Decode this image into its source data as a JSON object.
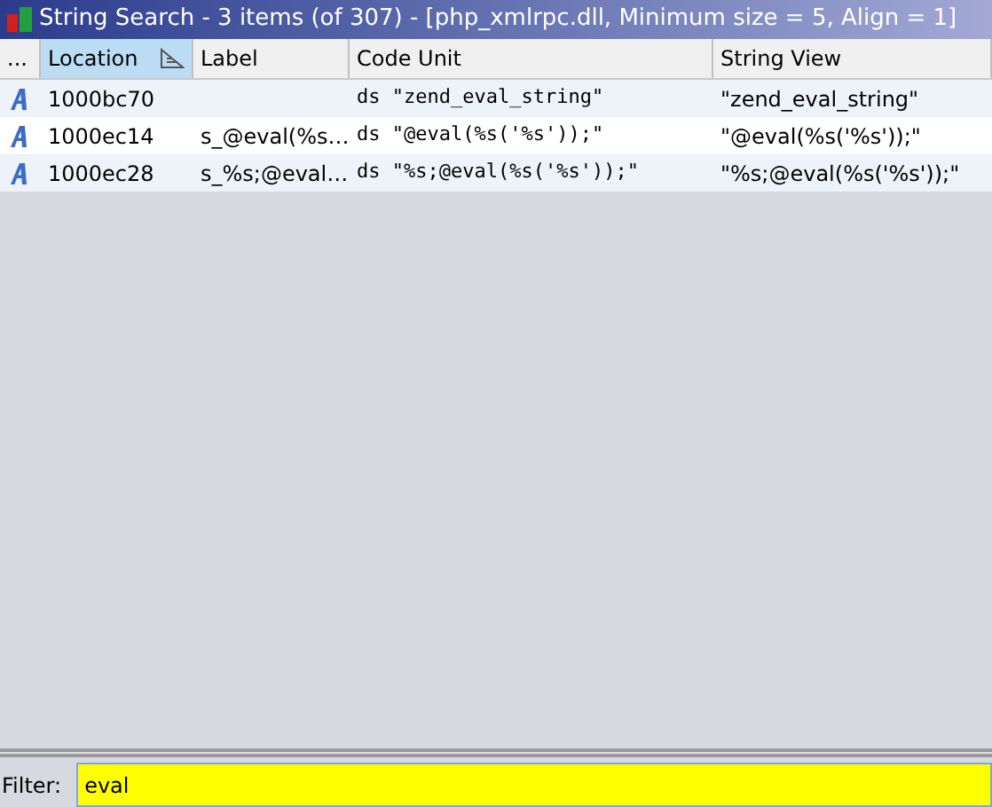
{
  "window": {
    "title": "String Search - 3 items (of 307) - [php_xmlrpc.dll, Minimum size = 5, Align = 1]"
  },
  "table": {
    "columns": [
      {
        "label": "...",
        "selected": false
      },
      {
        "label": "Location",
        "selected": true
      },
      {
        "label": "Label",
        "selected": false
      },
      {
        "label": "Code Unit",
        "selected": false
      },
      {
        "label": "String View",
        "selected": false
      }
    ],
    "rows": [
      {
        "location": "1000bc70",
        "label": "",
        "code_unit": "ds \"zend_eval_string\"",
        "string_view": "\"zend_eval_string\""
      },
      {
        "location": "1000ec14",
        "label": "s_@eval(%s…",
        "code_unit": "ds \"@eval(%s('%s'));\"",
        "string_view": "\"@eval(%s('%s'));\""
      },
      {
        "location": "1000ec28",
        "label": "s_%s;@eval…",
        "code_unit": "ds \"%s;@eval(%s('%s'));\"",
        "string_view": "\"%s;@eval(%s('%s'));\""
      }
    ]
  },
  "filter": {
    "label": "Filter:",
    "value": "eval"
  }
}
